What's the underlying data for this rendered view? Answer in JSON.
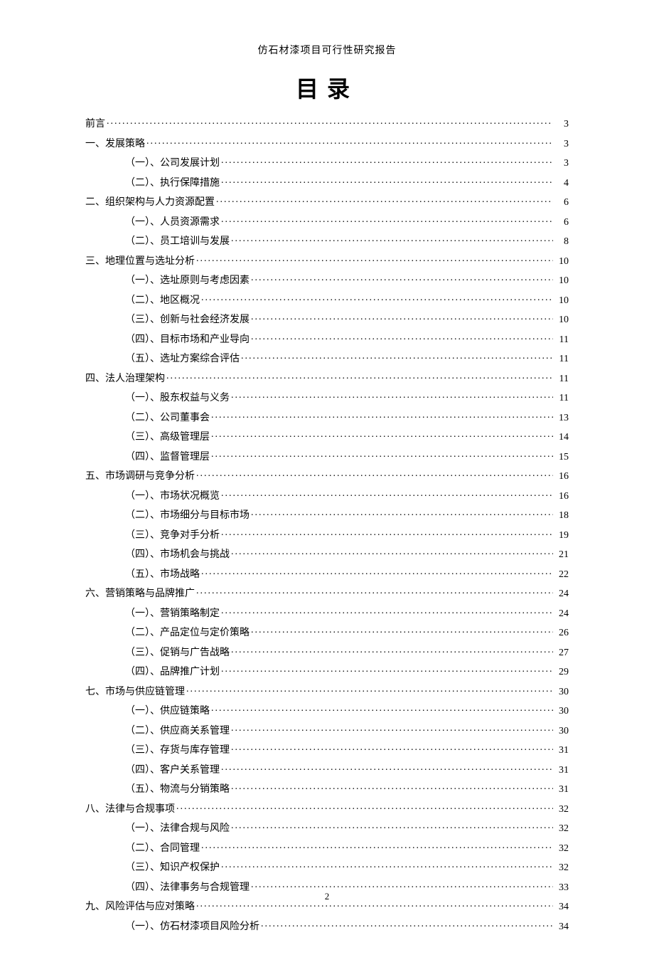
{
  "doc_header": "仿石材漆项目可行性研究报告",
  "title": "目录",
  "page_number": "2",
  "toc": [
    {
      "level": 1,
      "label": "前言",
      "page": "3"
    },
    {
      "level": 1,
      "label": "一、发展策略",
      "page": "3"
    },
    {
      "level": 2,
      "label": "（一）、公司发展计划",
      "page": "3"
    },
    {
      "level": 2,
      "label": "（二）、执行保障措施",
      "page": "4"
    },
    {
      "level": 1,
      "label": "二、组织架构与人力资源配置",
      "page": "6"
    },
    {
      "level": 2,
      "label": "（一）、人员资源需求",
      "page": "6"
    },
    {
      "level": 2,
      "label": "（二）、员工培训与发展",
      "page": "8"
    },
    {
      "level": 1,
      "label": "三、地理位置与选址分析",
      "page": "10"
    },
    {
      "level": 2,
      "label": "（一）、选址原则与考虑因素",
      "page": "10"
    },
    {
      "level": 2,
      "label": "（二）、地区概况",
      "page": "10"
    },
    {
      "level": 2,
      "label": "（三）、创新与社会经济发展",
      "page": "10"
    },
    {
      "level": 2,
      "label": "（四）、目标市场和产业导向",
      "page": "11"
    },
    {
      "level": 2,
      "label": "（五）、选址方案综合评估",
      "page": "11"
    },
    {
      "level": 1,
      "label": "四、法人治理架构",
      "page": "11"
    },
    {
      "level": 2,
      "label": "（一）、股东权益与义务",
      "page": "11"
    },
    {
      "level": 2,
      "label": "（二）、公司董事会",
      "page": "13"
    },
    {
      "level": 2,
      "label": "（三）、高级管理层",
      "page": "14"
    },
    {
      "level": 2,
      "label": "（四）、监督管理层",
      "page": "15"
    },
    {
      "level": 1,
      "label": "五、市场调研与竞争分析",
      "page": "16"
    },
    {
      "level": 2,
      "label": "（一）、市场状况概览",
      "page": "16"
    },
    {
      "level": 2,
      "label": "（二）、市场细分与目标市场",
      "page": "18"
    },
    {
      "level": 2,
      "label": "（三）、竞争对手分析",
      "page": "19"
    },
    {
      "level": 2,
      "label": "（四）、市场机会与挑战",
      "page": "21"
    },
    {
      "level": 2,
      "label": "（五）、市场战略",
      "page": "22"
    },
    {
      "level": 1,
      "label": "六、营销策略与品牌推广",
      "page": "24"
    },
    {
      "level": 2,
      "label": "（一）、营销策略制定",
      "page": "24"
    },
    {
      "level": 2,
      "label": "（二）、产品定位与定价策略",
      "page": "26"
    },
    {
      "level": 2,
      "label": "（三）、促销与广告战略",
      "page": "27"
    },
    {
      "level": 2,
      "label": "（四）、品牌推广计划",
      "page": "29"
    },
    {
      "level": 1,
      "label": "七、市场与供应链管理",
      "page": "30"
    },
    {
      "level": 2,
      "label": "（一）、供应链策略",
      "page": "30"
    },
    {
      "level": 2,
      "label": "（二）、供应商关系管理",
      "page": "30"
    },
    {
      "level": 2,
      "label": "（三）、存货与库存管理",
      "page": "31"
    },
    {
      "level": 2,
      "label": "（四）、客户关系管理",
      "page": "31"
    },
    {
      "level": 2,
      "label": "（五）、物流与分销策略",
      "page": "31"
    },
    {
      "level": 1,
      "label": "八、法律与合规事项",
      "page": "32"
    },
    {
      "level": 2,
      "label": "（一）、法律合规与风险",
      "page": "32"
    },
    {
      "level": 2,
      "label": "（二）、合同管理",
      "page": "32"
    },
    {
      "level": 2,
      "label": "（三）、知识产权保护",
      "page": "32"
    },
    {
      "level": 2,
      "label": "（四）、法律事务与合规管理",
      "page": "33"
    },
    {
      "level": 1,
      "label": "九、风险评估与应对策略",
      "page": "34"
    },
    {
      "level": 2,
      "label": "（一）、仿石材漆项目风险分析",
      "page": "34"
    }
  ]
}
